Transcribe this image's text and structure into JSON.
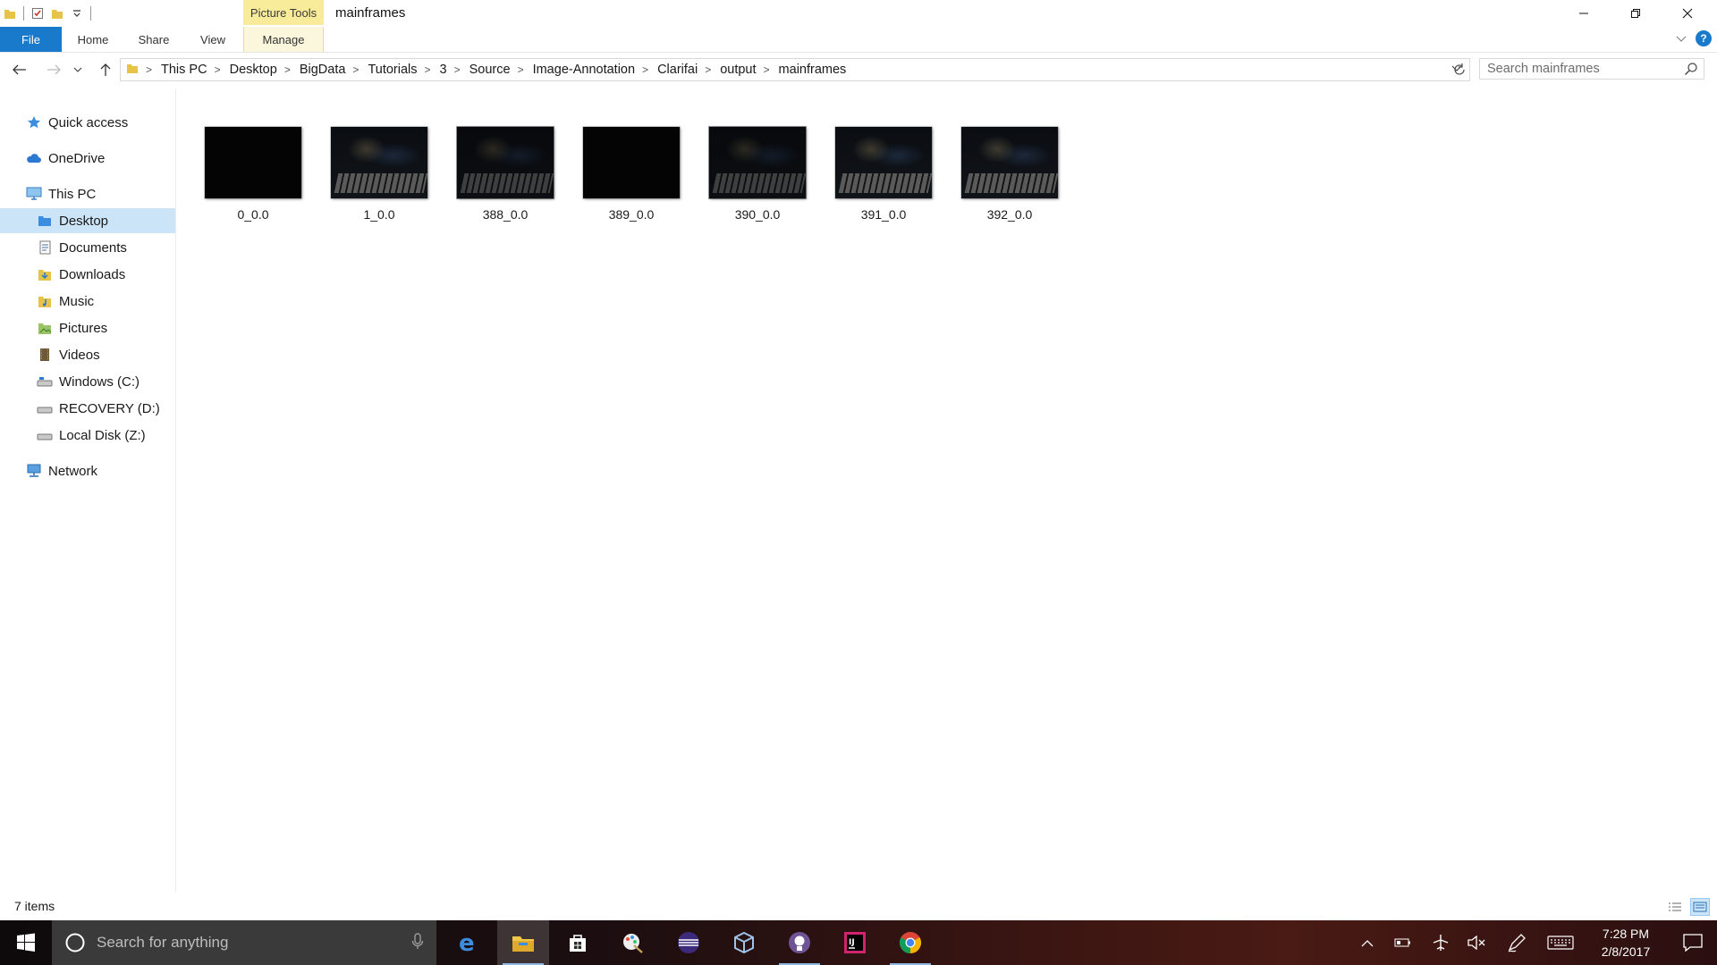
{
  "window": {
    "title": "mainframes",
    "context_tab": "Picture Tools"
  },
  "ribbon": {
    "tabs": [
      "File",
      "Home",
      "Share",
      "View",
      "Manage"
    ]
  },
  "address": {
    "crumbs": [
      "This PC",
      "Desktop",
      "BigData",
      "Tutorials",
      "3",
      "Source",
      "Image-Annotation",
      "Clarifai",
      "output",
      "mainframes"
    ]
  },
  "search": {
    "placeholder": "Search mainframes"
  },
  "sidebar": {
    "items": [
      {
        "label": "Quick access",
        "icon": "star-icon"
      },
      {
        "label": "OneDrive",
        "icon": "cloud-icon"
      },
      {
        "label": "This PC",
        "icon": "computer-icon"
      },
      {
        "label": "Desktop",
        "icon": "folder-icon"
      },
      {
        "label": "Documents",
        "icon": "documents-icon"
      },
      {
        "label": "Downloads",
        "icon": "downloads-icon"
      },
      {
        "label": "Music",
        "icon": "music-icon"
      },
      {
        "label": "Pictures",
        "icon": "pictures-icon"
      },
      {
        "label": "Videos",
        "icon": "videos-icon"
      },
      {
        "label": "Windows (C:)",
        "icon": "drive-icon"
      },
      {
        "label": "RECOVERY (D:)",
        "icon": "drive-icon"
      },
      {
        "label": "Local Disk (Z:)",
        "icon": "drive-icon"
      },
      {
        "label": "Network",
        "icon": "network-icon"
      }
    ],
    "selected": "Desktop"
  },
  "files": [
    {
      "name": "0_0.0",
      "thumb": "black"
    },
    {
      "name": "1_0.0",
      "thumb": "piano"
    },
    {
      "name": "388_0.0",
      "thumb": "piano-dim"
    },
    {
      "name": "389_0.0",
      "thumb": "black"
    },
    {
      "name": "390_0.0",
      "thumb": "piano-dim"
    },
    {
      "name": "391_0.0",
      "thumb": "piano"
    },
    {
      "name": "392_0.0",
      "thumb": "piano"
    }
  ],
  "status": {
    "items_count": "7 items"
  },
  "taskbar": {
    "search_placeholder": "Search for anything",
    "apps": [
      "edge-icon",
      "file-explorer-icon",
      "store-icon",
      "paint-icon",
      "eclipse-icon",
      "virtualbox-icon",
      "github-icon",
      "intellij-icon",
      "chrome-icon"
    ],
    "time": "7:28 PM",
    "date": "2/8/2017"
  },
  "colors": {
    "accent": "#1979ca",
    "context_tab": "#f8eb9a",
    "selected": "#cce4f7",
    "taskbar_search": "#3a3a3a"
  }
}
